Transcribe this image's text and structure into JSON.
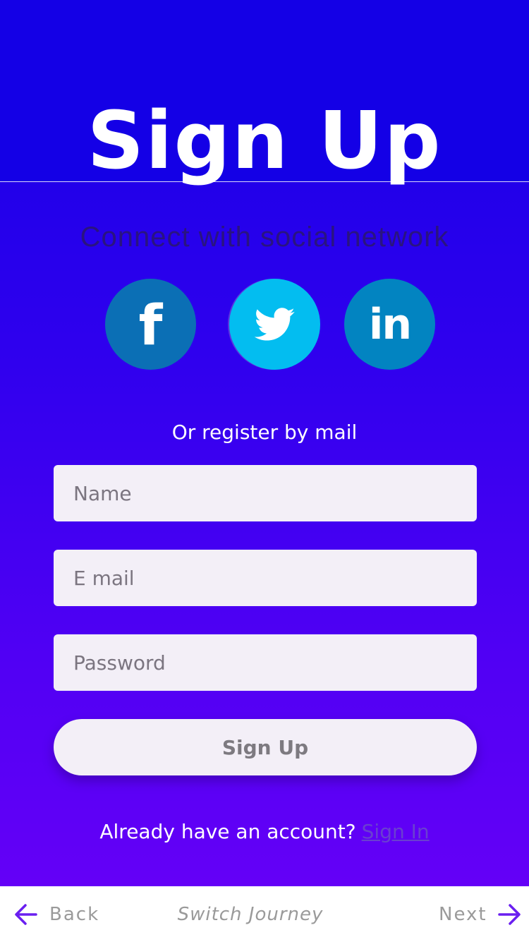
{
  "header": {
    "title": "Sign Up"
  },
  "social": {
    "heading": "Connect with social network",
    "buttons": [
      {
        "name": "facebook",
        "glyph": "f",
        "color": "#0b6fb5"
      },
      {
        "name": "twitter",
        "glyph": "bird",
        "color": "#03bdf0"
      },
      {
        "name": "linkedin",
        "glyph": "in",
        "color": "#0284c1"
      }
    ]
  },
  "form": {
    "or_text": "Or register by mail",
    "name_placeholder": "Name",
    "email_placeholder": "E mail",
    "password_placeholder": "Password",
    "submit_label": "Sign Up"
  },
  "footer": {
    "already_text": "Already have an account?",
    "signin_link": "Sign In"
  },
  "bottom_nav": {
    "back_label": "Back",
    "center_label": "Switch Journey",
    "next_label": "Next",
    "arrow_color": "#6a1ff0"
  },
  "colors": {
    "background_top": "#1400e6",
    "background_bottom": "#6400f7",
    "field_bg": "#f3eff7"
  }
}
